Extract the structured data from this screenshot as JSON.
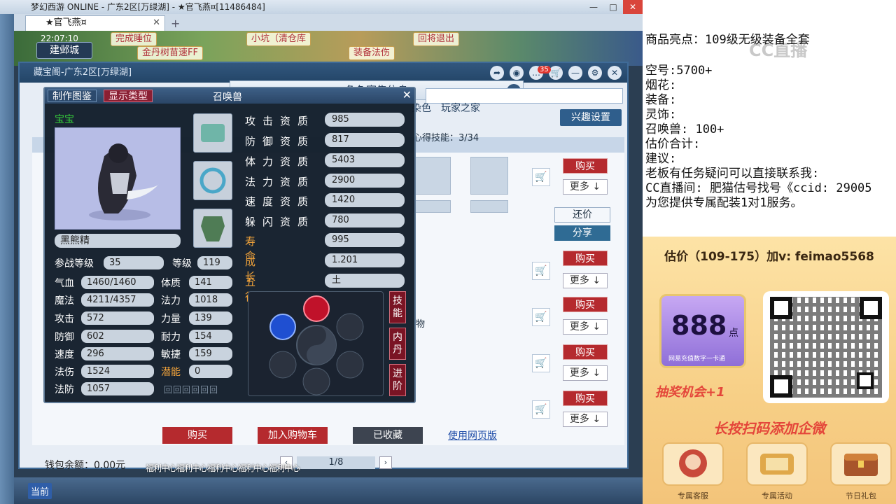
{
  "game": {
    "window_title": "梦幻西游 ONLINE - 广东2区[万绿湖] - ★官飞燕¤[11486484]",
    "tab_label": "★官飞燕¤",
    "date": "22:07:10",
    "city": "建邺城",
    "quests": [
      "完成睡位",
      "小坑（清仓库",
      "回将退出",
      "金丹树苗速FF",
      "装备法伤"
    ]
  },
  "cbg": {
    "header": "藏宝阁-广东2区[万绿湖]",
    "notification_count": "35",
    "dialog_title": "角色寄售信息",
    "nav_tabs": [
      "染色",
      "玩家之家"
    ],
    "interest_button": "兴趣设置",
    "skills_progress": "心得技能：3/34",
    "buy_label": "购买",
    "more_label": "更多 ↓",
    "bargain_label": "还价",
    "share_label": "分享",
    "item_partial": "物",
    "bottom": {
      "buy": "购买",
      "add_cart": "加入购物车",
      "favorited": "已收藏",
      "web_version": "使用网页版"
    },
    "wallet": "钱包余额：0.00元",
    "page": "1/8"
  },
  "pet": {
    "tab_atlas": "制作图鉴",
    "tab_display": "显示类型",
    "title": "召唤兽",
    "baby_label": "宝宝",
    "name": "黑熊精",
    "battle_level_label": "参战等级",
    "battle_level": "35",
    "level_label": "等级",
    "level": "119",
    "stats_left": [
      {
        "label": "气血",
        "value": "1460/1460"
      },
      {
        "label": "魔法",
        "value": "4211/4357"
      },
      {
        "label": "攻击",
        "value": "572"
      },
      {
        "label": "防御",
        "value": "602"
      },
      {
        "label": "速度",
        "value": "296"
      },
      {
        "label": "法伤",
        "value": "1524"
      },
      {
        "label": "法防",
        "value": "1057"
      }
    ],
    "stats_mid": [
      {
        "label": "体质",
        "value": "141"
      },
      {
        "label": "法力",
        "value": "1018"
      },
      {
        "label": "力量",
        "value": "139"
      },
      {
        "label": "耐力",
        "value": "154"
      },
      {
        "label": "敏捷",
        "value": "159"
      },
      {
        "label": "潜能",
        "value": "0"
      }
    ],
    "aptitudes": [
      {
        "label": "攻击资质",
        "value": "985"
      },
      {
        "label": "防御资质",
        "value": "817"
      },
      {
        "label": "体力资质",
        "value": "5403"
      },
      {
        "label": "法力资质",
        "value": "2900"
      },
      {
        "label": "速度资质",
        "value": "1420"
      },
      {
        "label": "躲闪资质",
        "value": "780"
      }
    ],
    "lifespan_label": "寿命",
    "lifespan": "995",
    "growth_label": "成长",
    "growth": "1.201",
    "element_label": "五行",
    "element": "土",
    "side_buttons": [
      "技能",
      "内丹",
      "进阶"
    ]
  },
  "subtitle": "福利中心福利中心福利中心福利中心福利中心",
  "bottom_bar_label": "当前",
  "notes": {
    "lines": [
      "商品亮点：109级无级装备全套",
      "空号:5700+",
      "烟花:",
      "装备:",
      "灵饰:",
      "召唤兽: 100+",
      "估价合计:",
      "建议:",
      "老板有任务疑问可以直接联系我:",
      "CC直播间: 肥猫估号找号《ccid: 29005",
      "为您提供专属配装1对1服务。"
    ],
    "watermark": "CC直播"
  },
  "promo": {
    "title": "估价（109-175）加v: feimao5568",
    "card_number": "888",
    "card_unit": "点",
    "card_sub": "网易充值数字一卡通",
    "lottery": "抽奖机会+1",
    "scan_tip": "长按扫码添加企微",
    "bottom_icons": [
      {
        "icon": "customer-service-icon",
        "label": "专属客服"
      },
      {
        "icon": "scroll-icon",
        "label": "专属活动"
      },
      {
        "icon": "treasure-chest-icon",
        "label": "节日礼包"
      }
    ]
  }
}
